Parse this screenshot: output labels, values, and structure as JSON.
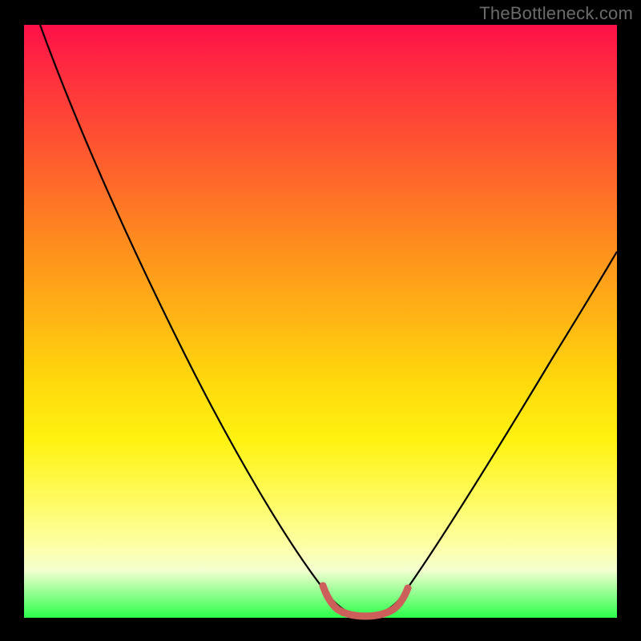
{
  "watermark": "TheBottleneck.com",
  "chart_data": {
    "type": "line",
    "title": "",
    "xlabel": "",
    "ylabel": "",
    "xlim": [
      0,
      100
    ],
    "ylim": [
      0,
      100
    ],
    "series": [
      {
        "name": "bottleneck-curve",
        "x": [
          3,
          10,
          20,
          30,
          40,
          48,
          52,
          56,
          60,
          64,
          70,
          80,
          90,
          100
        ],
        "y": [
          100,
          86,
          68,
          50,
          32,
          13,
          3,
          0.5,
          0.5,
          3,
          12,
          28,
          44,
          60
        ]
      },
      {
        "name": "optimal-plateau",
        "x": [
          52,
          54,
          56,
          58,
          60,
          62,
          64
        ],
        "y": [
          3.2,
          1.8,
          1.0,
          0.5,
          0.5,
          1.2,
          3.0
        ]
      }
    ],
    "colors": {
      "curve": "#000000",
      "plateau": "#cd5f5a",
      "gradient_top": "#ff1048",
      "gradient_bottom": "#2bff4a"
    }
  }
}
